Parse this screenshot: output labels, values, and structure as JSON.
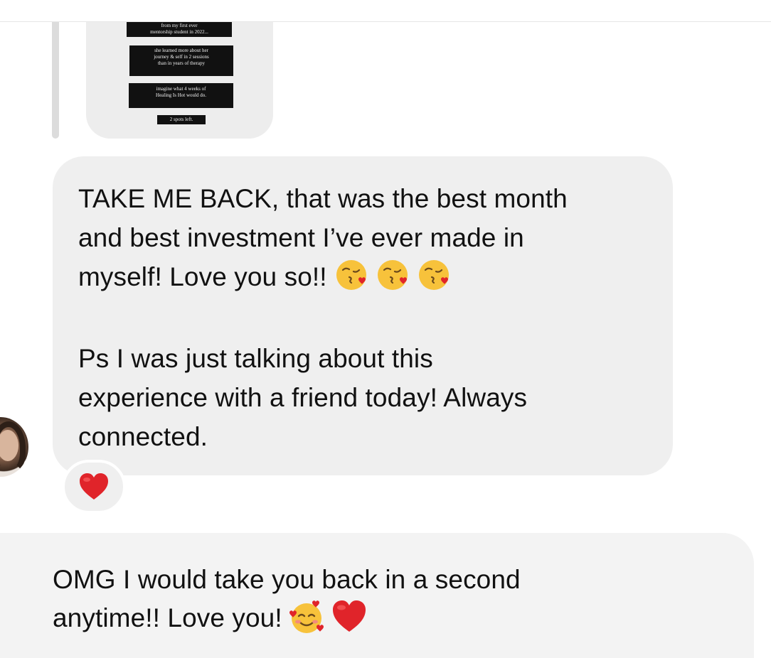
{
  "story_reply": {
    "lines": [
      "from my first ever\nmentorship student in 2022...",
      "she learned more about her\njourney & self in 2 sessions\nthan in years of therapy",
      "imagine what 4 weeks of\nHealing Is Hot would do.",
      "2 spots left."
    ]
  },
  "incoming_message": {
    "paragraph_1": "TAKE ME BACK, that was the best month\nand best investment I’ve ever made in\nmyself! Love you so!!",
    "emojis_1": [
      "kissing-face-with-heart-emoji",
      "kissing-face-with-heart-emoji",
      "kissing-face-with-heart-emoji"
    ],
    "paragraph_2": "Ps I was just talking about this\nexperience with a friend today! Always\nconnected.",
    "reaction": "red-heart-emoji"
  },
  "outgoing_message": {
    "text": "OMG I would take you back in a second\nanytime!! Love you!",
    "emojis": [
      "smiling-face-with-hearts-emoji",
      "red-heart-emoji"
    ]
  },
  "colors": {
    "incoming_bubble": "#efefef",
    "outgoing_bubble": "#f3f3f3",
    "heart": "#e0242a",
    "emoji_face": "#f7c23b"
  }
}
